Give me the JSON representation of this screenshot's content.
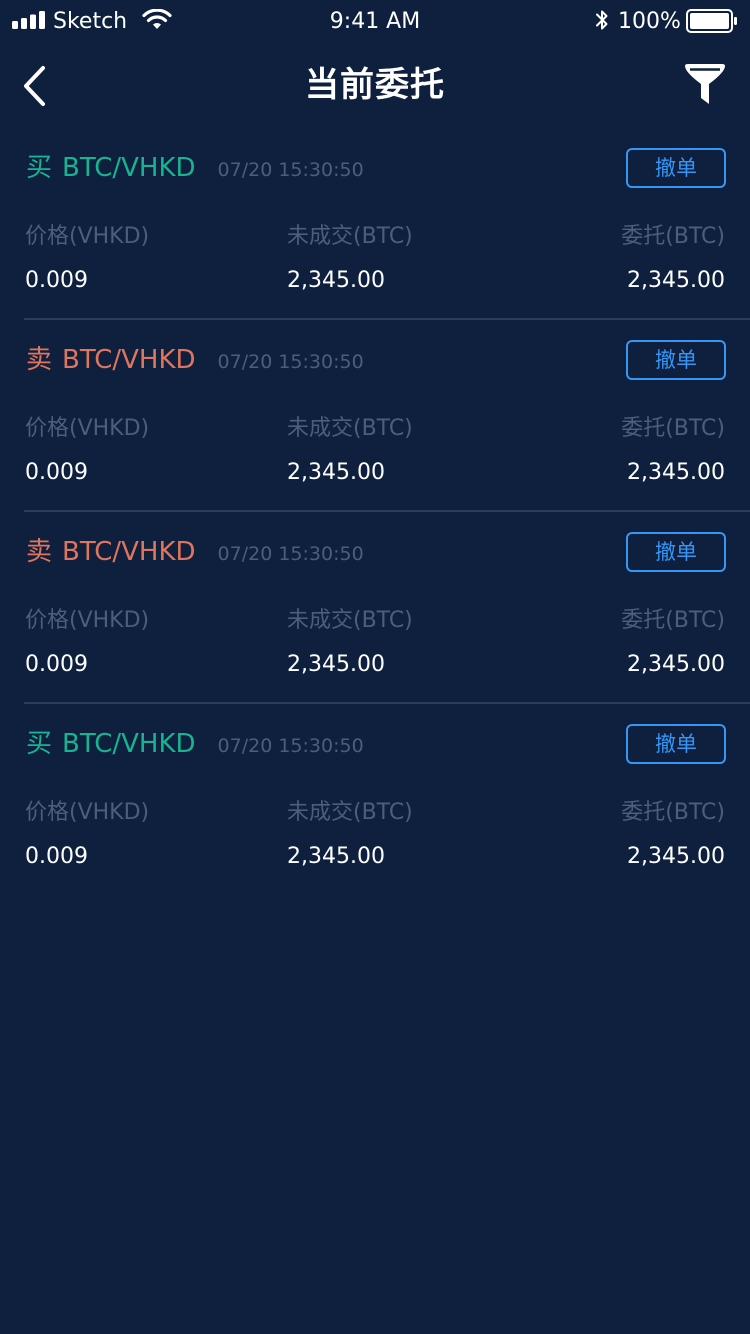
{
  "status_bar": {
    "carrier": "Sketch",
    "time": "9:41 AM",
    "battery": "100%"
  },
  "nav": {
    "title": "当前委托"
  },
  "columns": {
    "price": "价格(VHKD)",
    "unfilled": "未成交(BTC)",
    "entrusted": "委托(BTC)"
  },
  "cancel_label": "撤单",
  "colors": {
    "background": "#0e203d",
    "buy": "#16b491",
    "sell": "#e0755e",
    "accent": "#3596f5",
    "muted": "#4a5e7d"
  },
  "orders": [
    {
      "side": "买",
      "side_type": "buy",
      "pair": "BTC/VHKD",
      "time": "07/20 15:30:50",
      "price": "0.009",
      "unfilled": "2,345.00",
      "entrusted": "2,345.00"
    },
    {
      "side": "卖",
      "side_type": "sell",
      "pair": "BTC/VHKD",
      "time": "07/20 15:30:50",
      "price": "0.009",
      "unfilled": "2,345.00",
      "entrusted": "2,345.00"
    },
    {
      "side": "卖",
      "side_type": "sell",
      "pair": "BTC/VHKD",
      "time": "07/20 15:30:50",
      "price": "0.009",
      "unfilled": "2,345.00",
      "entrusted": "2,345.00"
    },
    {
      "side": "买",
      "side_type": "buy",
      "pair": "BTC/VHKD",
      "time": "07/20 15:30:50",
      "price": "0.009",
      "unfilled": "2,345.00",
      "entrusted": "2,345.00"
    }
  ]
}
